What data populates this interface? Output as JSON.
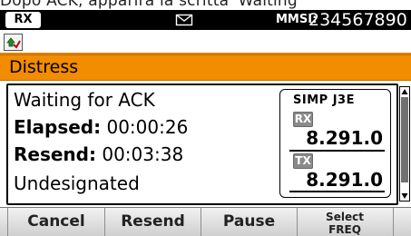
{
  "caption": "Dopo ACK, apparirà la scritta 'Waiting",
  "status": {
    "mode_badge": "RX",
    "mmsi_label": "MMSI:",
    "mmsi_value": "234567890"
  },
  "title": "Distress",
  "info": {
    "status_text": "Waiting for ACK",
    "elapsed_label": "Elapsed:",
    "elapsed_value": "00:00:26",
    "resend_label": "Resend:",
    "resend_value": "00:03:38",
    "position_text": "Undesignated"
  },
  "frequency": {
    "mode": "SIMP J3E",
    "rx_tag": "RX",
    "rx_value": "8.291.0",
    "tx_tag": "TX",
    "tx_value": "8.291.0"
  },
  "softkeys": {
    "cancel": "Cancel",
    "resend": "Resend",
    "pause": "Pause",
    "select_line1": "Select",
    "select_line2": "FREQ"
  },
  "icons": {
    "mail": "mail-icon",
    "mode": "dsc-mode-icon"
  },
  "colors": {
    "accent": "#f28c00",
    "statusbar": "#000000",
    "tag": "#8a8a8a"
  }
}
